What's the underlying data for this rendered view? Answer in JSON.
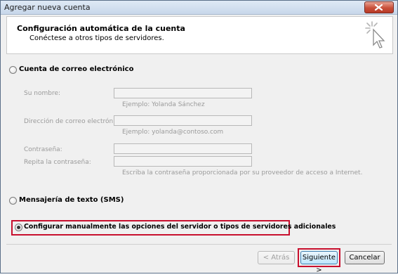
{
  "window": {
    "title": "Agregar nueva cuenta"
  },
  "header": {
    "title": "Configuración automática de la cuenta",
    "subtitle": "Conéctese a otros tipos de servidores."
  },
  "options": {
    "email_label": "Cuenta de correo electrónico",
    "sms_label": "Mensajería de texto (SMS)",
    "manual_label": "Configurar manualmente las opciones del servidor o tipos de servidores adicionales",
    "selected": "manual"
  },
  "form": {
    "name_label": "Su nombre:",
    "name_value": "",
    "name_hint": "Ejemplo: Yolanda Sánchez",
    "email_label": "Dirección de correo electrónico:",
    "email_value": "",
    "email_hint": "Ejemplo: yolanda@contoso.com",
    "password_label": "Contraseña:",
    "password_value": "",
    "repeat_label": "Repita la contraseña:",
    "repeat_value": "",
    "password_hint": "Escriba la contraseña proporcionada por su proveedor de acceso a Internet."
  },
  "buttons": {
    "back": "< Atrás",
    "next": "Siguiente >",
    "cancel": "Cancelar"
  },
  "colors": {
    "highlight": "#c8102e",
    "close_button": "#c9503a"
  },
  "icons": {
    "close": "close-icon",
    "wizard": "wizard-cursor-icon"
  }
}
